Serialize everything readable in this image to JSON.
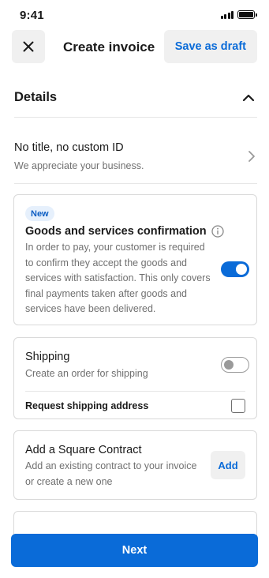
{
  "status_bar": {
    "time": "9:41"
  },
  "header": {
    "title": "Create invoice",
    "save_draft_label": "Save as draft"
  },
  "details": {
    "section_title": "Details",
    "title_row": {
      "primary": "No title, no custom ID",
      "secondary": "We appreciate your business."
    }
  },
  "goods_confirmation": {
    "badge": "New",
    "title": "Goods and services confirmation",
    "description_lines": [
      "In order to pay, your customer is required",
      "to confirm they accept the goods and",
      "services with satisfaction. This only covers",
      "final payments taken after goods and",
      "services have been delivered."
    ],
    "enabled": true
  },
  "shipping": {
    "title": "Shipping",
    "description": "Create an order for shipping",
    "enabled": false,
    "request_address_label": "Request shipping address",
    "request_address_checked": false
  },
  "contract": {
    "title": "Add a Square Contract",
    "description_lines": [
      "Add an existing contract to your invoice",
      "or create a new one"
    ],
    "add_label": "Add"
  },
  "footer": {
    "next_label": "Next"
  },
  "colors": {
    "accent": "#0a6bd8",
    "badge_bg": "#e6f0fc",
    "button_bg": "#f0f0f0",
    "border": "#d9d9d9"
  }
}
